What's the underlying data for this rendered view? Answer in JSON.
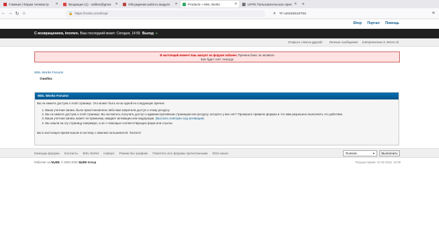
{
  "tabs": [
    {
      "title": "Главная | Форум телевастр",
      "active": false
    },
    {
      "title": "Входящие (1) - vidikon@gmai",
      "active": false
    },
    {
      "title": "Обсуждение работы модуля",
      "active": false
    },
    {
      "title": "Products » MSL Works",
      "active": true
    },
    {
      "title": "UFPE Пользовательское прил",
      "active": false
    }
  ],
  "browser": {
    "url": "https://mslw.com/shop/",
    "search_text": "TF-LED40S19T2S"
  },
  "header": {
    "links": [
      "Shop",
      "Портал",
      "Помощь"
    ]
  },
  "panel": {
    "welcome_prefix": "С возвращением,",
    "username": "knomen.",
    "last_visit": "Ваш последний визит: Сегодня, 14:55",
    "logout": "Выход"
  },
  "subnav": {
    "buddy_list": "Открыть список друзей",
    "pm": "Личные сообщения",
    "pm_counts": "(Непрочитано 0, Всего 0)"
  },
  "alert": {
    "line1_lead": "В настоящий момент ваш аккаунт на форуме забанен.",
    "line1_rest": "Причина бана: не активати",
    "line2": "Бан будет снят: Никогда"
  },
  "breadcrumb": {
    "forum": "MSL Works Forums",
    "current": "Ошибка"
  },
  "error_box": {
    "title": "MSL Works Forums",
    "intro": "Вы не имеете доступа к этой странице. Это может быть из-за одной из следующих причин:",
    "reasons": [
      "Ваша учетная запись была приостановлена либо вам запретили доступ к этому ресурсу.",
      "Вы не имеете доступа к этой странице. Вы пытаетесь получить доступ к административным страницам или ресурсу, которого у вас нет? Проверьте правила форума и что вам разрешено выполнить это действие.",
      "Ваша учетная запись может по-прежнему ожидает активации или модерации.",
      "Вы зашли на эту страницу напрямую, а не с помощью соответствующих форм или ссылок."
    ],
    "resend_link": "(Выслать повторно код активации)",
    "logged_in": "Вы в настоящее время вошли в систему с именем пользователя: 'knomen'"
  },
  "footer": {
    "links": [
      "Команда форума",
      "Контакты",
      "MSL Works",
      "Наверх",
      "Режим без графики",
      "Пометить все форумы прочитанными",
      "RSS канал"
    ],
    "language": "Russian",
    "go_button": "Выполнить",
    "powered": "Работает на",
    "mybb": "MyBB",
    "copyright": ", © 2002-2022",
    "mybb_group": "MyBB Group",
    "time": "Текущее время: 01-02-2022, 16:39"
  },
  "colors": {
    "panel_bg": "#202020",
    "link": "#0f5c8e",
    "alert_bg": "#ffe2e2",
    "box_head": "#0a6fb0"
  }
}
